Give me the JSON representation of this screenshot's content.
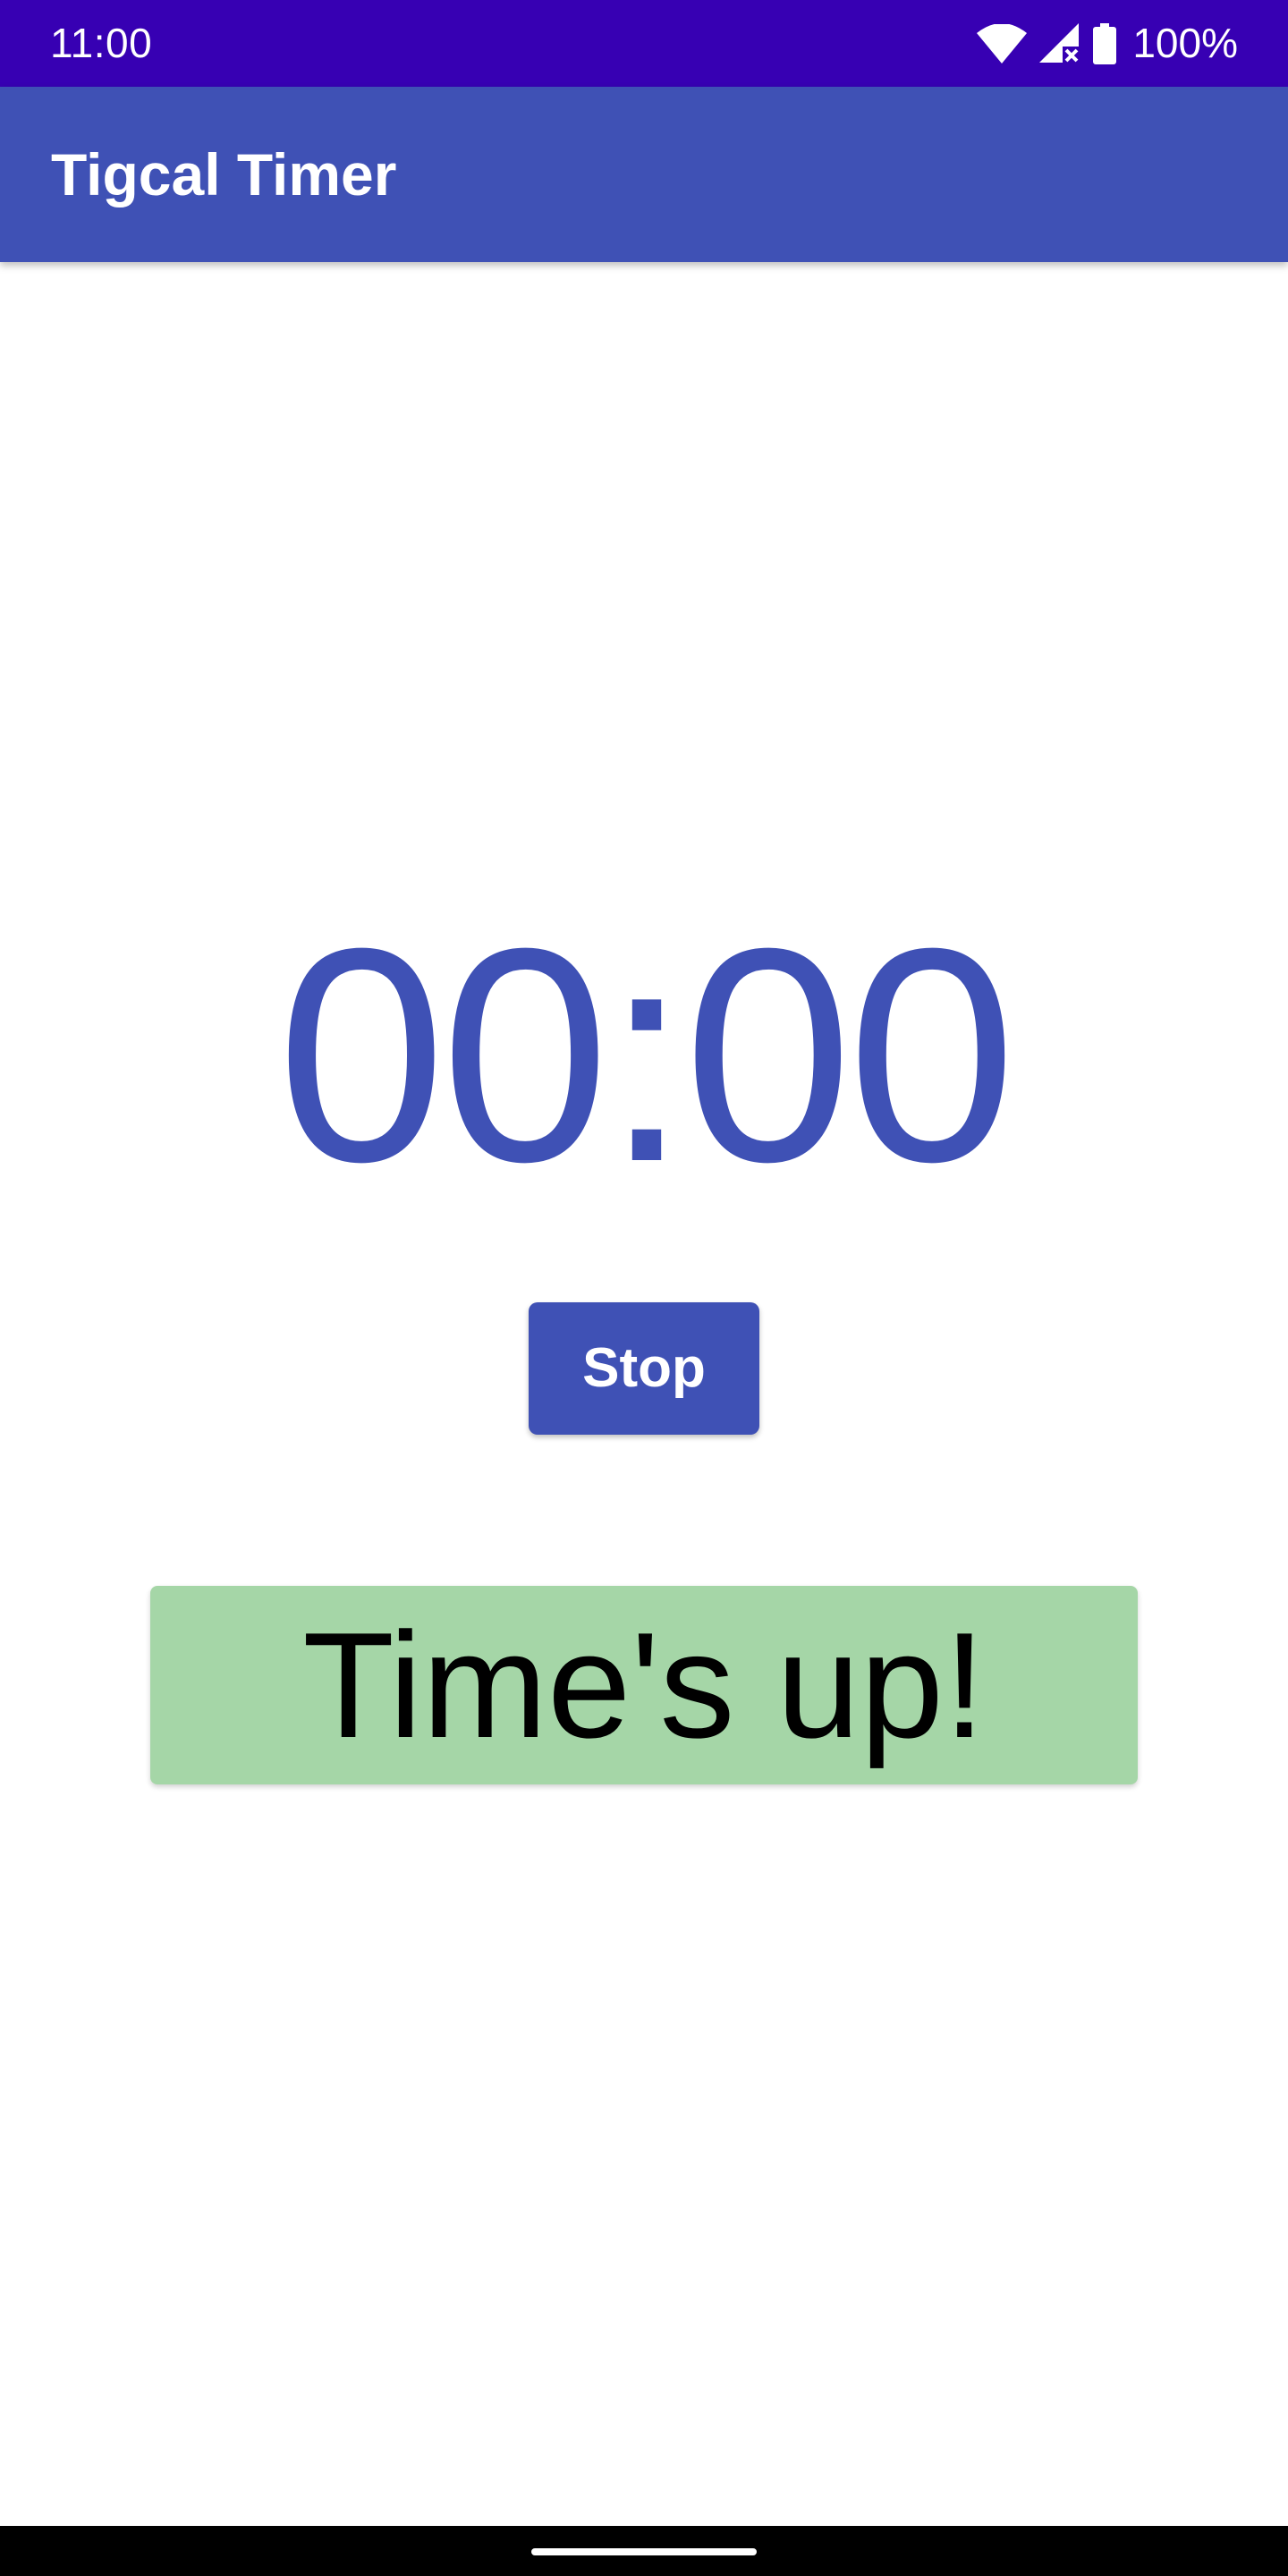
{
  "status_bar": {
    "time": "11:00",
    "battery": "100%",
    "icons": [
      "wifi-icon",
      "cellular-no-service-icon",
      "battery-icon"
    ],
    "background_color": "#3700B3"
  },
  "app_bar": {
    "title": "Tigcal Timer",
    "background_color": "#3F51B5"
  },
  "timer": {
    "display": "00:00",
    "color": "#3F51B5"
  },
  "controls": {
    "stop_label": "Stop"
  },
  "alert": {
    "message": "Time's up!",
    "background_color": "#A5D6A7"
  }
}
